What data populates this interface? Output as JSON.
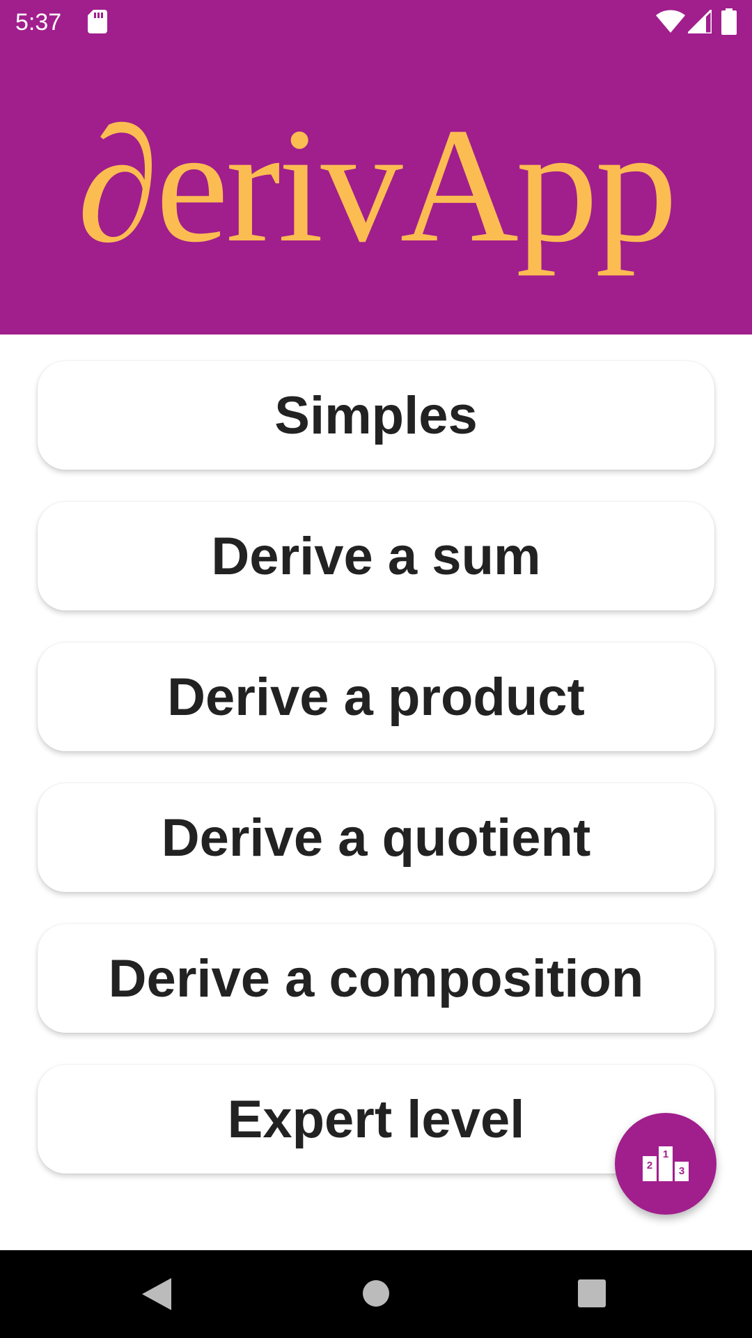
{
  "status_bar": {
    "time": "5:37",
    "icons": [
      "sd-card-icon",
      "wifi-icon",
      "signal-icon",
      "battery-icon"
    ]
  },
  "header": {
    "logo_text": "∂erivApp"
  },
  "menu": {
    "items": [
      {
        "label": "Simples"
      },
      {
        "label": "Derive a sum"
      },
      {
        "label": "Derive a product"
      },
      {
        "label": "Derive a quotient"
      },
      {
        "label": "Derive a composition"
      },
      {
        "label": "Expert level"
      }
    ]
  },
  "fab": {
    "icon": "podium-icon"
  },
  "nav_bar": {
    "icons": [
      "back-icon",
      "home-icon",
      "recents-icon"
    ]
  },
  "colors": {
    "brand_purple": "#a11e8d",
    "logo_gold": "#fbbd52",
    "button_text": "#222222",
    "background": "#ffffff"
  }
}
